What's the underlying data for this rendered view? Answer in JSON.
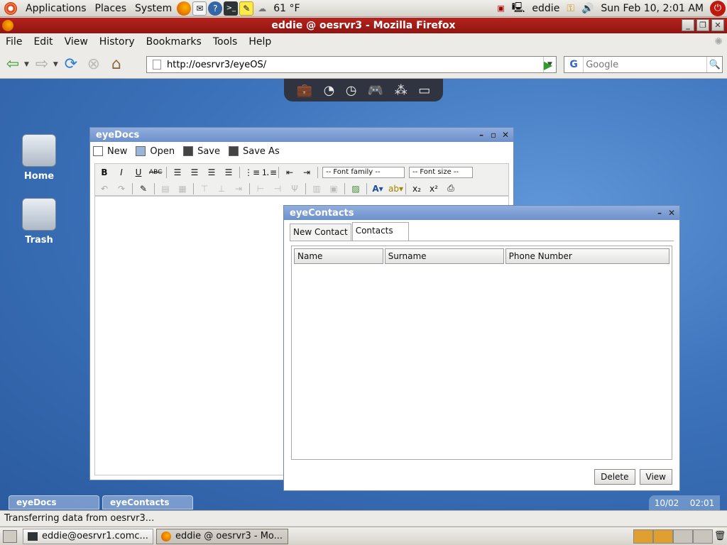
{
  "gnome_top": {
    "menus": [
      "Applications",
      "Places",
      "System"
    ],
    "weather": "61 °F",
    "user": "eddie",
    "clock": "Sun Feb 10,  2:01 AM"
  },
  "firefox": {
    "title": "eddie @ oesrvr3 - Mozilla Firefox",
    "menu": [
      "File",
      "Edit",
      "View",
      "History",
      "Bookmarks",
      "Tools",
      "Help"
    ],
    "url": "http://oesrvr3/eyeOS/",
    "search_placeholder": "Google",
    "status": "Transferring data from oesrvr3..."
  },
  "desktop": {
    "icons": [
      {
        "label": "Home"
      },
      {
        "label": "Trash"
      }
    ]
  },
  "eyedocs": {
    "title": "eyeDocs",
    "toolbar": {
      "new": "New",
      "open": "Open",
      "save": "Save",
      "save_as": "Save As"
    },
    "font_family": "-- Font family --",
    "font_size": "-- Font size --"
  },
  "eyecontacts": {
    "title": "eyeContacts",
    "tabs": [
      "New Contact",
      "Contacts"
    ],
    "columns": [
      "Name",
      "Surname",
      "Phone Number"
    ],
    "buttons": {
      "delete": "Delete",
      "view": "View"
    }
  },
  "eyeos_taskbar": {
    "tabs": [
      "eyeDocs",
      "eyeContacts"
    ],
    "date": "10/02",
    "time": "02:01"
  },
  "gnome_bottom": {
    "tasks": [
      "eddie@oesrvr1.comc...",
      "eddie @ oesrvr3 - Mo..."
    ]
  }
}
